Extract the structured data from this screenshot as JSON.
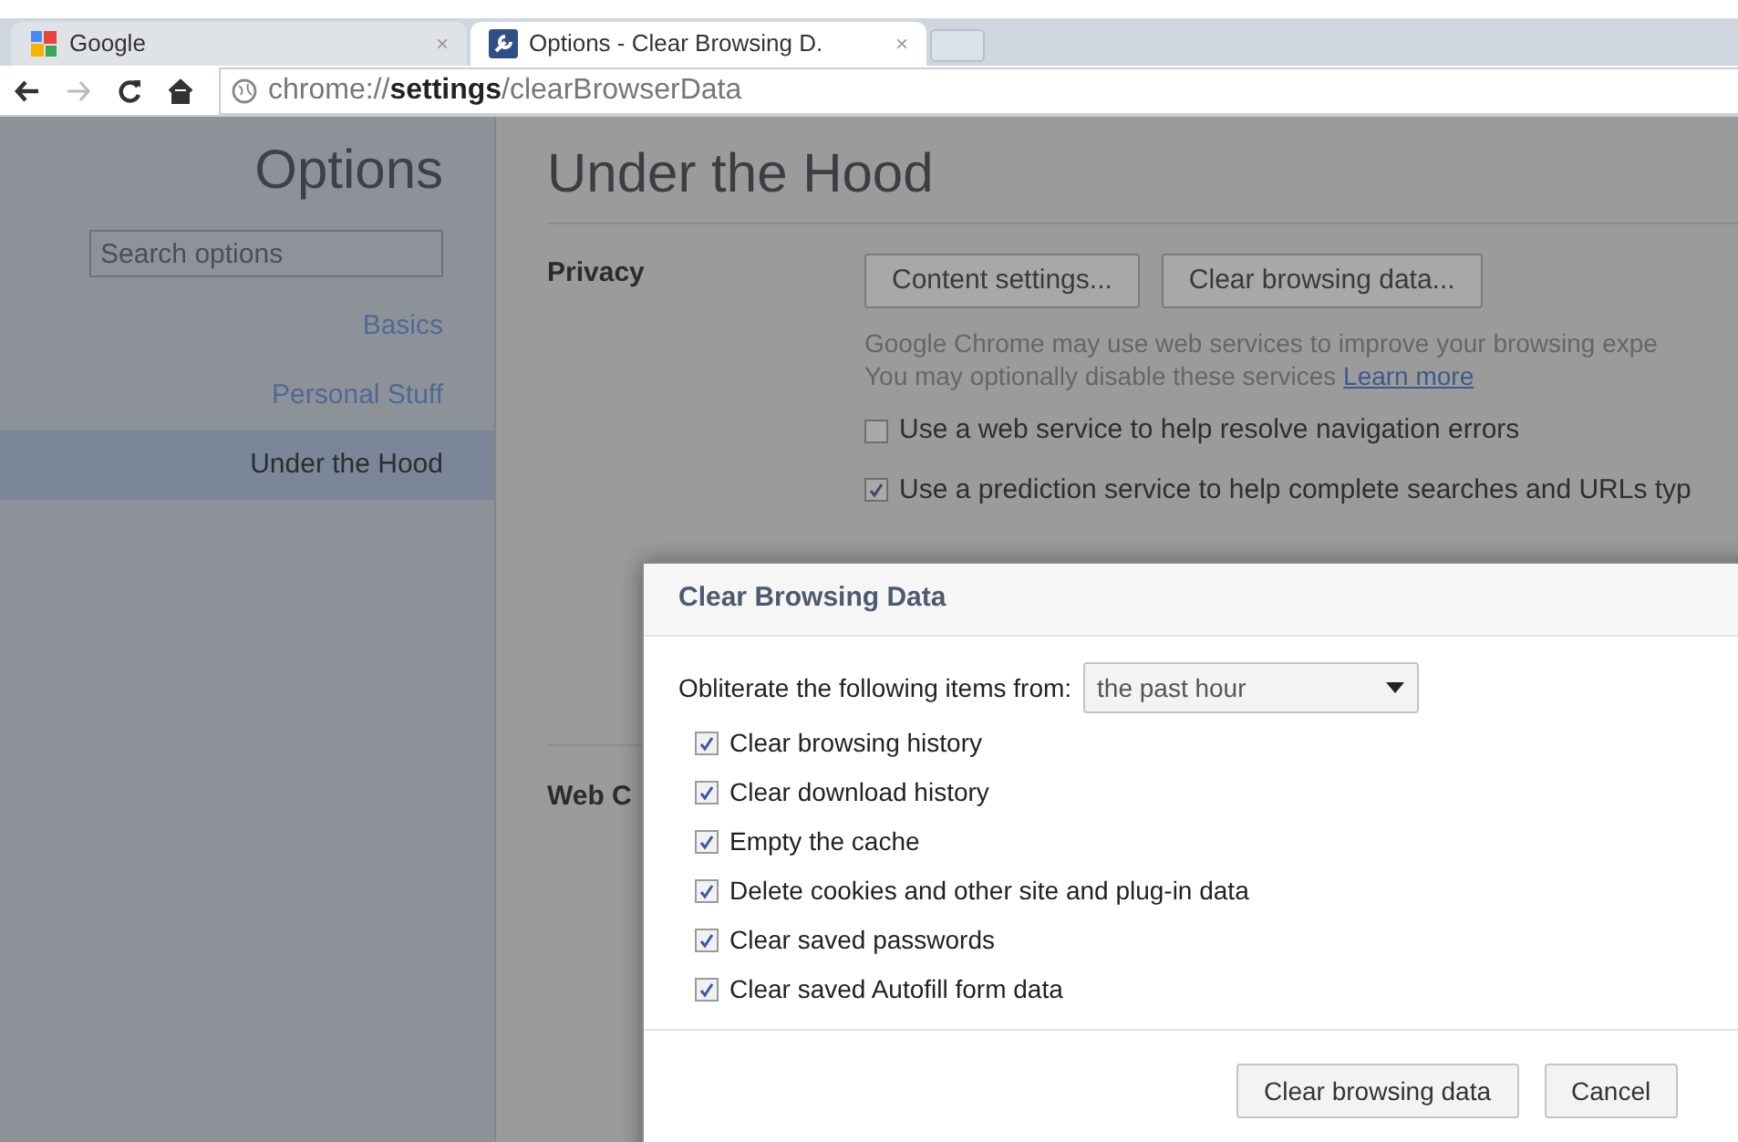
{
  "tabs": [
    {
      "title": "Google",
      "close": "×",
      "selected": false
    },
    {
      "title": "Options - Clear Browsing D.",
      "close": "×",
      "selected": true
    }
  ],
  "toolbar": {
    "url_scheme": "chrome://",
    "url_host": "settings",
    "url_path": "/clearBrowserData"
  },
  "sidebar": {
    "title": "Options",
    "search": {
      "placeholder": "Search options"
    },
    "items": [
      {
        "label": "Basics",
        "selected": false
      },
      {
        "label": "Personal Stuff",
        "selected": false
      },
      {
        "label": "Under the Hood",
        "selected": true
      }
    ]
  },
  "page": {
    "title": "Under the Hood",
    "privacy": {
      "label": "Privacy",
      "buttons": [
        "Content settings...",
        "Clear browsing data..."
      ],
      "description": "Google Chrome may use web services to improve your browsing expe",
      "description2": "You may optionally disable these services",
      "link": "Learn more",
      "options": [
        {
          "label": "Use a web service to help resolve navigation errors",
          "checked": false
        },
        {
          "label": "Use a prediction service to help complete searches and URLs typ",
          "checked": true
        }
      ]
    },
    "web_content_label": "Web C"
  },
  "dialog": {
    "title": "Clear Browsing Data",
    "range_label": "Obliterate the following items from:",
    "range_value": "the past hour",
    "items": [
      {
        "label": "Clear browsing history",
        "checked": true
      },
      {
        "label": "Clear download history",
        "checked": true
      },
      {
        "label": "Empty the cache",
        "checked": true
      },
      {
        "label": "Delete cookies and other site and plug-in data",
        "checked": true
      },
      {
        "label": "Clear saved passwords",
        "checked": true
      },
      {
        "label": "Clear saved Autofill form data",
        "checked": true
      }
    ],
    "buttons": [
      "Clear browsing data",
      "Cancel"
    ]
  }
}
